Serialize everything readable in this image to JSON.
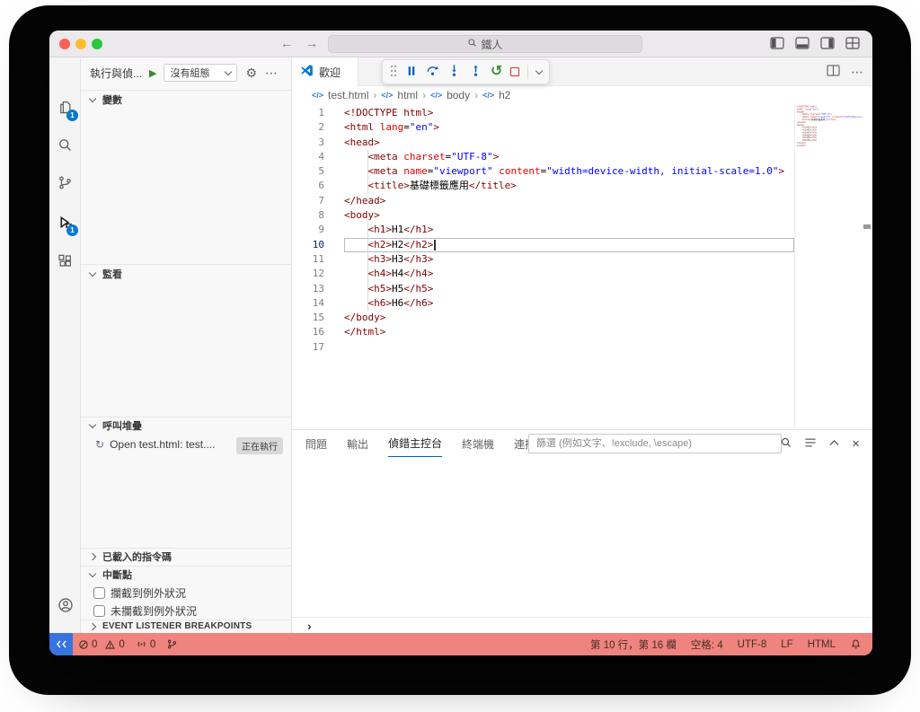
{
  "colors": {
    "status_bar": "#ef837d",
    "remote_indicator": "#3674e2",
    "badge": "#0a7acc",
    "syntax_tag": "#800000",
    "syntax_attr": "#e50000",
    "syntax_value": "#0000ff",
    "accent": "#005fb8",
    "debug_green": "#388a34",
    "debug_red": "#cf3131"
  },
  "icons": {
    "back": "←",
    "forward": "→",
    "more": "⋯",
    "gear": "⚙",
    "restart": "↺",
    "spinner": "↻",
    "close": "×",
    "play": "▶",
    "code": "</>"
  },
  "titlebar": {
    "search_text": "鐵人"
  },
  "activity_bar": {
    "explorer_badge": "1",
    "debug_badge": "1"
  },
  "sidebar": {
    "title": "執行與偵...",
    "config_dropdown": "沒有組態",
    "variables": "變數",
    "watch": "監看",
    "call_stack": "呼叫堆疊",
    "call_stack_item": "Open test.html: test....",
    "running_badge": "正在執行",
    "loaded_scripts": "已載入的指令碼",
    "breakpoints": "中斷點",
    "bp_caught": "攔截到例外狀況",
    "bp_uncaught": "未攔截到例外狀況",
    "event_listener": "EVENT LISTENER BREAKPOINTS"
  },
  "editor": {
    "tab_label": "歡迎",
    "breadcrumbs": [
      "test.html",
      "html",
      "body",
      "h2"
    ],
    "current_line": 10,
    "lines": [
      [
        [
          "tg",
          "<!DOCTYPE html>"
        ]
      ],
      [
        [
          "tg",
          "<html "
        ],
        [
          "at",
          "lang"
        ],
        [
          "pl",
          "="
        ],
        [
          "vl",
          "\"en\""
        ],
        [
          "tg",
          ">"
        ]
      ],
      [
        [
          "tg",
          "<head>"
        ]
      ],
      [
        [
          "tg",
          "    <meta "
        ],
        [
          "at",
          "charset"
        ],
        [
          "pl",
          "="
        ],
        [
          "vl",
          "\"UTF-8\""
        ],
        [
          "tg",
          ">"
        ]
      ],
      [
        [
          "tg",
          "    <meta "
        ],
        [
          "at",
          "name"
        ],
        [
          "pl",
          "="
        ],
        [
          "vl",
          "\"viewport\""
        ],
        [
          "tg",
          " "
        ],
        [
          "at",
          "content"
        ],
        [
          "pl",
          "="
        ],
        [
          "vl",
          "\"width=device-width, initial-scale=1.0\""
        ],
        [
          "tg",
          ">"
        ]
      ],
      [
        [
          "tg",
          "    <title>"
        ],
        [
          "tx",
          "基礎標籤應用"
        ],
        [
          "tg",
          "</title>"
        ]
      ],
      [
        [
          "tg",
          "</head>"
        ]
      ],
      [
        [
          "tg",
          "<body>"
        ]
      ],
      [
        [
          "tg",
          "    <h1>"
        ],
        [
          "tx",
          "H1"
        ],
        [
          "tg",
          "</h1>"
        ]
      ],
      [
        [
          "tg",
          "    <h2>"
        ],
        [
          "tx",
          "H2"
        ],
        [
          "tg",
          "</h2>"
        ]
      ],
      [
        [
          "tg",
          "    <h3>"
        ],
        [
          "tx",
          "H3"
        ],
        [
          "tg",
          "</h3>"
        ]
      ],
      [
        [
          "tg",
          "    <h4>"
        ],
        [
          "tx",
          "H4"
        ],
        [
          "tg",
          "</h4>"
        ]
      ],
      [
        [
          "tg",
          "    <h5>"
        ],
        [
          "tx",
          "H5"
        ],
        [
          "tg",
          "</h5>"
        ]
      ],
      [
        [
          "tg",
          "    <h6>"
        ],
        [
          "tx",
          "H6"
        ],
        [
          "tg",
          "</h6>"
        ]
      ],
      [
        [
          "tg",
          "</body>"
        ]
      ],
      [
        [
          "tg",
          "</html>"
        ]
      ],
      []
    ]
  },
  "panel": {
    "tabs": [
      "問題",
      "輸出",
      "偵錯主控台",
      "終端機",
      "連接埠"
    ],
    "active_tab": "偵錯主控台",
    "filter_placeholder": "篩選 (例如文字、!exclude, \\escape)",
    "prompt": "›"
  },
  "status": {
    "errors": "0",
    "warnings": "0",
    "ports": "0",
    "line_col": "第 10 行，第 16 欄",
    "indent": "空格: 4",
    "encoding": "UTF-8",
    "eol": "LF",
    "language": "HTML"
  }
}
